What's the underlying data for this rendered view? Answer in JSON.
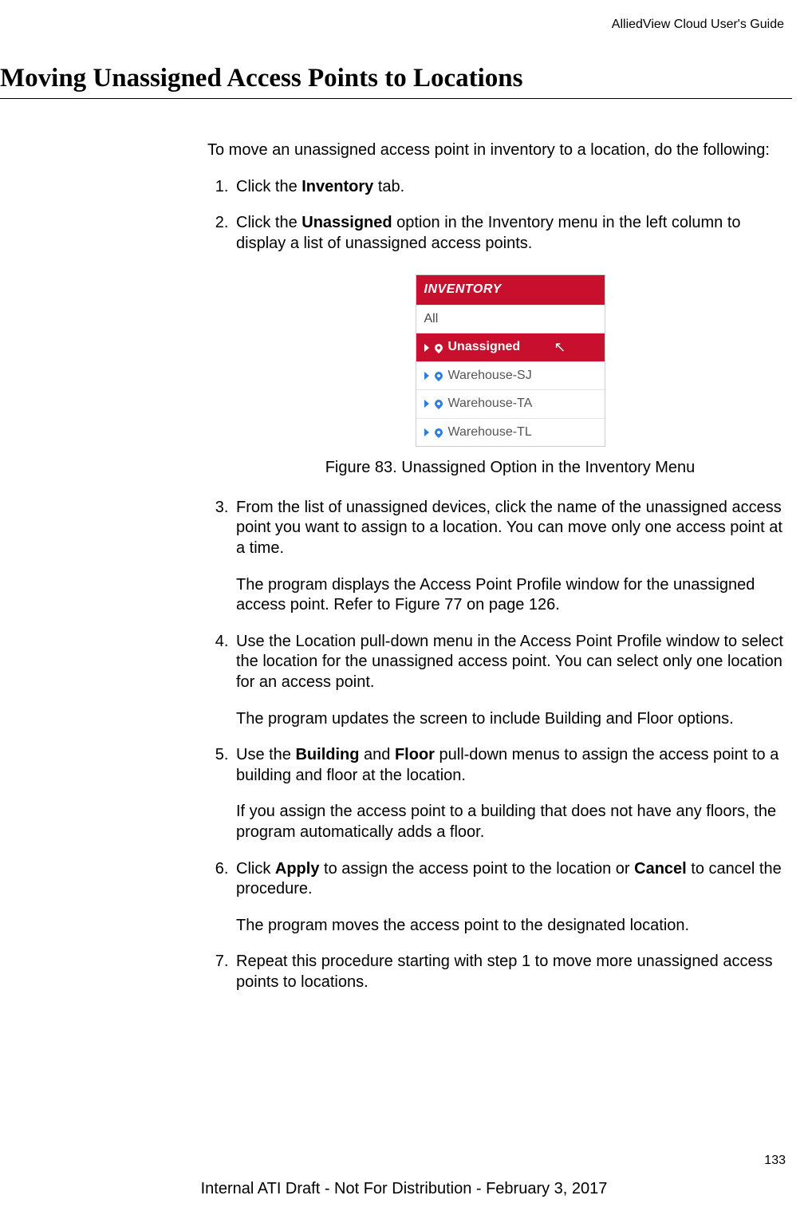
{
  "header": {
    "doc_title_right": "AlliedView Cloud User's Guide"
  },
  "title": "Moving Unassigned Access Points to Locations",
  "intro": "To move an unassigned access point in inventory to a location, do the following:",
  "steps": {
    "s1": {
      "prefix": "Click the ",
      "bold1": "Inventory",
      "suffix": " tab."
    },
    "s2": {
      "prefix": "Click the ",
      "bold1": "Unassigned",
      "suffix": " option in the Inventory menu in the left column to display a list of unassigned access points."
    },
    "s3": {
      "text": "From the list of unassigned devices, click the name of the unassigned access point you want to assign to a location. You can move only one access point at a time.",
      "sub": "The program displays the Access Point Profile window for the unassigned access point. Refer to Figure 77 on page 126."
    },
    "s4": {
      "text": "Use the Location pull-down menu in the Access Point Profile window to select the location for the unassigned access point. You can select only one location for an access point.",
      "sub": "The program updates the screen to include Building and Floor options."
    },
    "s5": {
      "prefix": "Use the ",
      "bold1": "Building",
      "mid": " and ",
      "bold2": "Floor",
      "suffix": " pull-down menus to assign the access point to a building and floor at the location.",
      "sub": "If you assign the access point to a building that does not have any floors, the program automatically adds a floor."
    },
    "s6": {
      "prefix": "Click ",
      "bold1": "Apply",
      "mid": " to assign the access point to the location or ",
      "bold2": "Cancel",
      "suffix": " to cancel the procedure.",
      "sub": "The program moves the access point to the designated location."
    },
    "s7": {
      "text": "Repeat this procedure starting with step 1 to move more unassigned access points to locations."
    }
  },
  "figure": {
    "caption": "Figure 83. Unassigned Option in the Inventory Menu",
    "menu": {
      "header": "INVENTORY",
      "items": {
        "all": "All",
        "unassigned": "Unassigned",
        "loc1": "Warehouse-SJ",
        "loc2": "Warehouse-TA",
        "loc3": "Warehouse-TL"
      }
    }
  },
  "page_number": "133",
  "footer": "Internal ATI Draft - Not For Distribution - February 3, 2017"
}
